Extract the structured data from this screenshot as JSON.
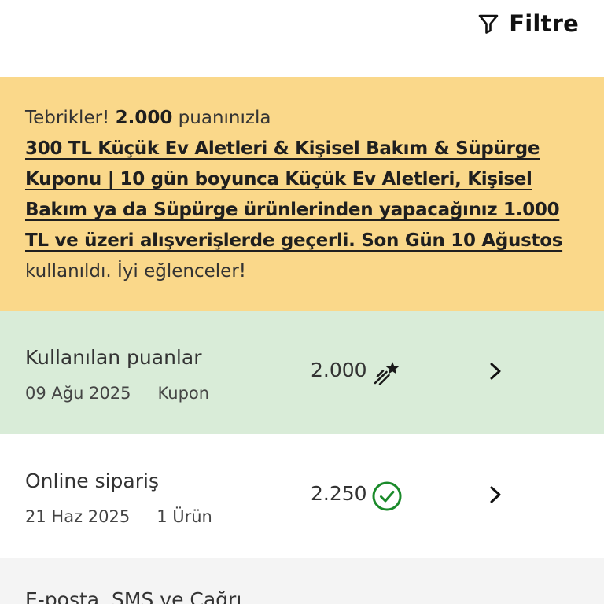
{
  "header": {
    "filter_label": "Filtre",
    "filter_icon": "funnel-icon"
  },
  "banner": {
    "prefix": "Tebrikler! ",
    "points": "2.000",
    "points_suffix": " puanınızla",
    "coupon_text": "300 TL Küçük Ev Aletleri & Kişisel Bakım & Süpürge Kuponu | 10 gün boyunca Küçük Ev Aletleri, Kişisel Bakım ya da Süpürge ürünlerinden yapacağınız 1.000 TL ve üzeri alışverişlerde geçerli. Son Gün 10 Ağustos",
    "suffix": " kullanıldı. İyi eğlenceler!",
    "background_color": "#fad88a"
  },
  "transactions": [
    {
      "title": "Kullanılan puanlar",
      "date": "09 Ağu 2025",
      "detail": "Kupon",
      "value": "2.000",
      "icon": "shooting-star-icon",
      "background_color": "#d9ecd8"
    },
    {
      "title": "Online sipariş",
      "date": "21 Haz 2025",
      "detail": "1 Ürün",
      "value": "2.250",
      "icon": "check-circle-icon",
      "icon_color": "#1a8a2a",
      "background_color": "#ffffff"
    },
    {
      "title": "E-posta, SMS ve Çağrı",
      "background_color": "#f4f4f4"
    }
  ]
}
